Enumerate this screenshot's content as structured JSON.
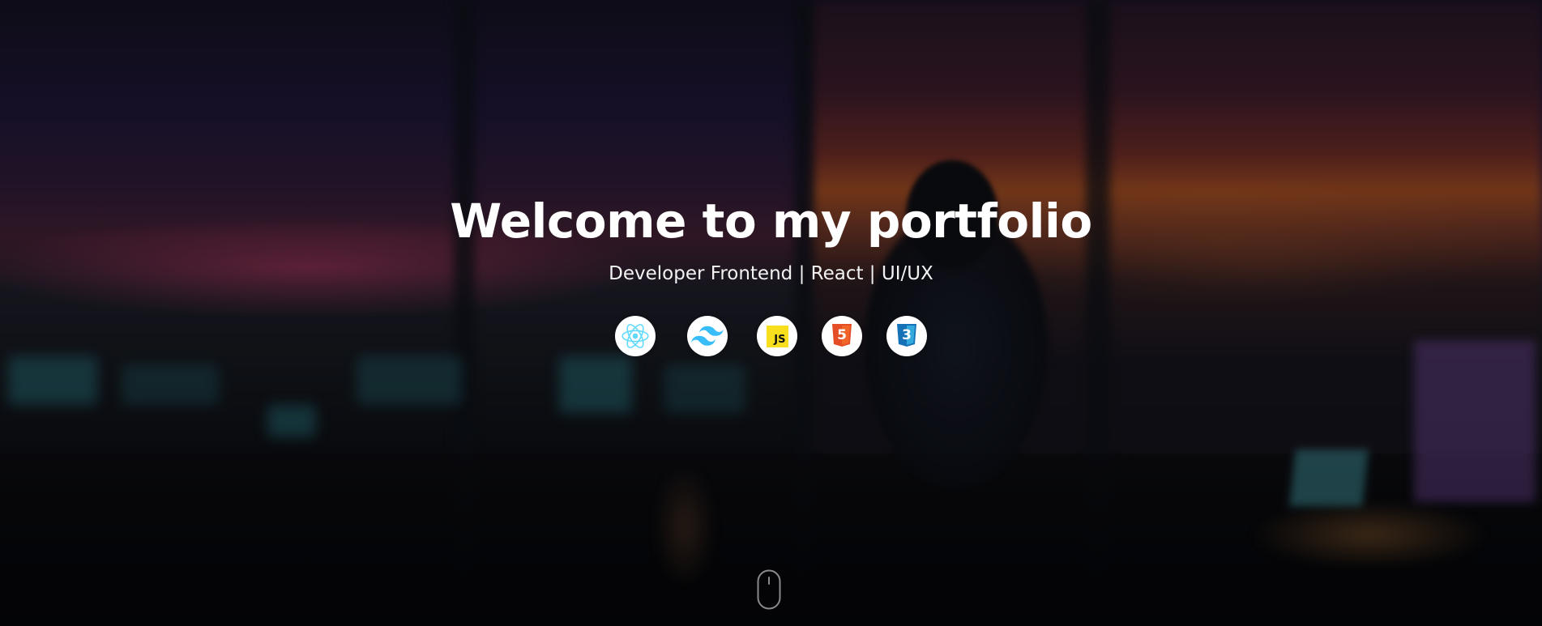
{
  "hero": {
    "title": "Welcome to my portfolio",
    "subtitle": "Developer Frontend | React | UI/UX"
  },
  "tech_stack": [
    {
      "name": "react-icon",
      "color": "#61dafb"
    },
    {
      "name": "tailwind-icon",
      "color": "#38bdf8"
    },
    {
      "name": "javascript-icon",
      "label": "JS",
      "color": "#f7df1e"
    },
    {
      "name": "html5-icon",
      "label": "5",
      "color": "#e44d26"
    },
    {
      "name": "css3-icon",
      "label": "3",
      "color": "#1572b6"
    }
  ],
  "scroll_indicator": {
    "icon": "mouse-icon"
  }
}
